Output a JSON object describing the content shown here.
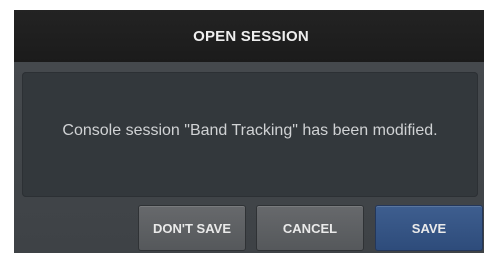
{
  "dialog": {
    "title": "OPEN SESSION",
    "message": "Console session \"Band Tracking\" has been modified."
  },
  "buttons": {
    "dont_save": "DON'T SAVE",
    "cancel": "CANCEL",
    "save": "SAVE"
  },
  "colors": {
    "titlebar": "#1f1f1f",
    "dialog_body": "#43474b",
    "message_panel": "#33383c",
    "button_gray": "#5f6265",
    "button_primary": "#365686"
  }
}
